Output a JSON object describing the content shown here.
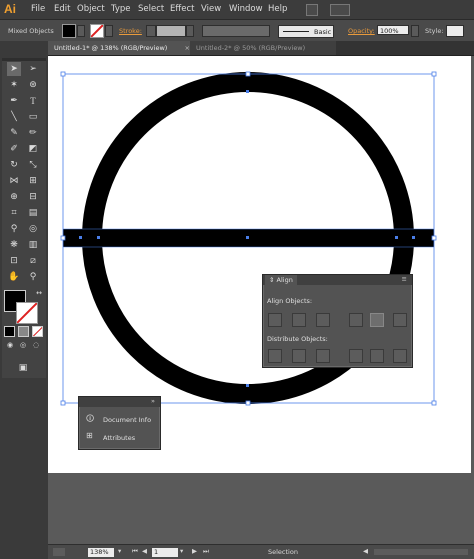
{
  "app": {
    "logo": "Ai",
    "menus": [
      "File",
      "Edit",
      "Object",
      "Type",
      "Select",
      "Effect",
      "View",
      "Window",
      "Help"
    ]
  },
  "control_bar": {
    "selection_label": "Mixed Objects",
    "stroke_label": "Stroke:",
    "stroke_style": "Basic",
    "opacity_label": "Opacity:",
    "opacity_value": "100%",
    "style_label": "Style:"
  },
  "tabs": [
    "Untitled-1* @ 138% (RGB/Preview)",
    "Untitled-2* @ 50% (RGB/Preview)"
  ],
  "align_panel": {
    "title": "Align",
    "align_objects_label": "Align Objects:",
    "distribute_objects_label": "Distribute Objects:"
  },
  "doc_panel": {
    "items": [
      "Document Info",
      "Attributes"
    ]
  },
  "status_bar": {
    "zoom": "138%",
    "page": "1",
    "mode": "Selection"
  },
  "colors": {
    "menu_bg": "#3c3c3c",
    "panel_bg": "#535353",
    "selection_blue": "#4a7ee8",
    "accent_orange": "#e89a3c"
  }
}
